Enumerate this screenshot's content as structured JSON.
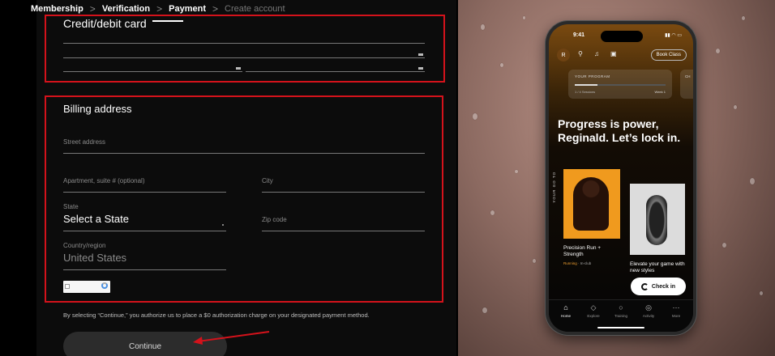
{
  "breadcrumb": [
    {
      "label": "Membership",
      "active": true
    },
    {
      "label": "Verification",
      "active": true
    },
    {
      "label": "Payment",
      "active": true
    },
    {
      "label": "Create account",
      "active": false
    }
  ],
  "breadcrumb_separator": ">",
  "card_section": {
    "title": "Credit/debit card"
  },
  "billing": {
    "title": "Billing address",
    "street_label": "Street address",
    "apartment_label": "Apartment, suite # (optional)",
    "city_label": "City",
    "state_label": "State",
    "state_value": "Select a State",
    "zip_label": "Zip code",
    "country_label": "Country/region",
    "country_value": "United States"
  },
  "disclaimer": "By selecting “Continue,” you authorize us to place a $0 authorization charge on your designated payment method.",
  "continue_label": "Continue",
  "colors": {
    "highlight": "#d4121b",
    "accent_orange": "#f09a1e"
  },
  "phone": {
    "time": "9:41",
    "avatar_initial": "R",
    "book_class": "Book Class",
    "program_label": "YOUR PROGRAM",
    "program_label_2": "CH",
    "program_sessions": "1 / 4 Sessions",
    "program_week": "Week 1",
    "program_progress": 0.25,
    "hero": "Progress is power, Reginald. Let’s lock in.",
    "go_to_label": "YOUR GO TO",
    "card1_title": "Precision Run + Strength",
    "card1_type": "Running",
    "card1_location": "· In-club",
    "card2_title": "Elevate your game with new styles",
    "checkin": "Check in",
    "tabs": [
      {
        "label": "Home",
        "icon": "home-icon",
        "glyph": "⌂"
      },
      {
        "label": "Explore",
        "icon": "explore-icon",
        "glyph": "◇"
      },
      {
        "label": "Training",
        "icon": "training-icon",
        "glyph": "○"
      },
      {
        "label": "Activity",
        "icon": "activity-icon",
        "glyph": "◎"
      },
      {
        "label": "More",
        "icon": "more-icon",
        "glyph": "⋯"
      }
    ]
  }
}
